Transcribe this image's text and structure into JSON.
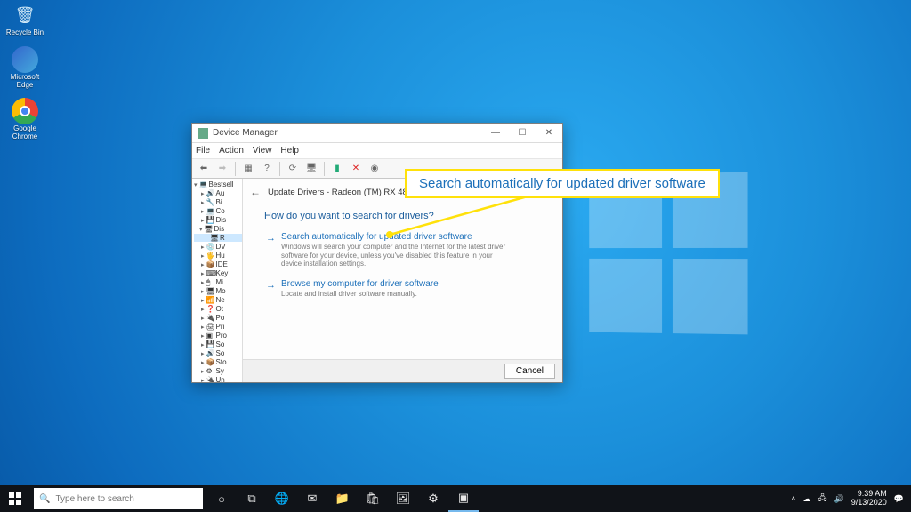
{
  "desktop": {
    "icons": [
      {
        "name": "recycle-bin",
        "label": "Recycle Bin",
        "glyph": "🗑",
        "bg": "transparent"
      },
      {
        "name": "edge",
        "label": "Microsoft Edge",
        "glyph": "🌐",
        "bg": "#1f7fd6"
      },
      {
        "name": "chrome",
        "label": "Google Chrome",
        "glyph": "◎",
        "bg": "#eab308"
      }
    ]
  },
  "window": {
    "title": "Device Manager",
    "menus": [
      "File",
      "Action",
      "View",
      "Help"
    ],
    "tree_root": "Bestsell",
    "tree_items": [
      {
        "l": "Au",
        "g": "🔊"
      },
      {
        "l": "Bi",
        "g": "🔧"
      },
      {
        "l": "Co",
        "g": "💻"
      },
      {
        "l": "Dis",
        "g": "💾"
      },
      {
        "l": "Dis",
        "g": "🖥",
        "expanded": true,
        "child": "R"
      },
      {
        "l": "DV",
        "g": "💿"
      },
      {
        "l": "Hu",
        "g": "🖐"
      },
      {
        "l": "IDE",
        "g": "📦"
      },
      {
        "l": "Key",
        "g": "⌨"
      },
      {
        "l": "Mi",
        "g": "🖱"
      },
      {
        "l": "Mo",
        "g": "🖥"
      },
      {
        "l": "Ne",
        "g": "📶"
      },
      {
        "l": "Ot",
        "g": "❓"
      },
      {
        "l": "Po",
        "g": "🔌"
      },
      {
        "l": "Pri",
        "g": "🖨"
      },
      {
        "l": "Pro",
        "g": "▣"
      },
      {
        "l": "So",
        "g": "💾"
      },
      {
        "l": "So",
        "g": "🔊"
      },
      {
        "l": "Sto",
        "g": "📦"
      },
      {
        "l": "Sy",
        "g": "⚙"
      },
      {
        "l": "Un",
        "g": "🔌"
      }
    ]
  },
  "dialog": {
    "header": "Update Drivers - Radeon (TM) RX 480 Graphics",
    "question": "How do you want to search for drivers?",
    "options": [
      {
        "title": "Search automatically for updated driver software",
        "desc": "Windows will search your computer and the Internet for the latest driver software for your device, unless you've disabled this feature in your device installation settings."
      },
      {
        "title": "Browse my computer for driver software",
        "desc": "Locate and install driver software manually."
      }
    ],
    "cancel": "Cancel"
  },
  "callout": {
    "text": "Search automatically for updated driver software"
  },
  "taskbar": {
    "search_placeholder": "Type here to search",
    "time": "9:39 AM",
    "date": "9/13/2020"
  }
}
